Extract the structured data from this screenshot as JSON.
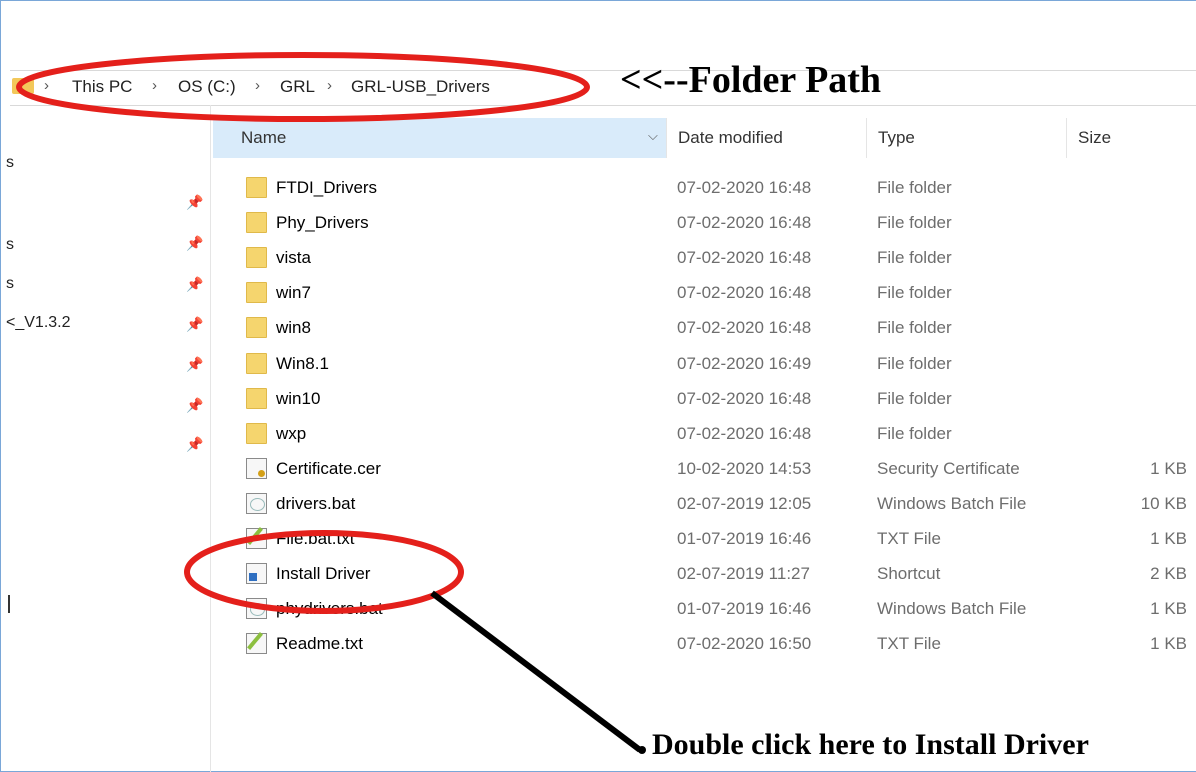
{
  "breadcrumb": [
    "This PC",
    "OS (C:)",
    "GRL",
    "GRL-USB_Drivers"
  ],
  "annotations": {
    "folder_path": "<<--Folder Path",
    "install_hint": "Double click here to Install Driver"
  },
  "nav_pane": {
    "items": [
      "s",
      "s",
      "s",
      "<_V1.3.2"
    ]
  },
  "columns": {
    "name": "Name",
    "date": "Date modified",
    "type": "Type",
    "size": "Size"
  },
  "files": [
    {
      "name": "FTDI_Drivers",
      "date": "07-02-2020 16:48",
      "type": "File folder",
      "size": "",
      "icon": "folder-icon"
    },
    {
      "name": "Phy_Drivers",
      "date": "07-02-2020 16:48",
      "type": "File folder",
      "size": "",
      "icon": "folder-icon"
    },
    {
      "name": "vista",
      "date": "07-02-2020 16:48",
      "type": "File folder",
      "size": "",
      "icon": "folder-icon"
    },
    {
      "name": "win7",
      "date": "07-02-2020 16:48",
      "type": "File folder",
      "size": "",
      "icon": "folder-icon"
    },
    {
      "name": "win8",
      "date": "07-02-2020 16:48",
      "type": "File folder",
      "size": "",
      "icon": "folder-icon"
    },
    {
      "name": "Win8.1",
      "date": "07-02-2020 16:49",
      "type": "File folder",
      "size": "",
      "icon": "folder-icon"
    },
    {
      "name": "win10",
      "date": "07-02-2020 16:48",
      "type": "File folder",
      "size": "",
      "icon": "folder-icon"
    },
    {
      "name": "wxp",
      "date": "07-02-2020 16:48",
      "type": "File folder",
      "size": "",
      "icon": "folder-icon"
    },
    {
      "name": "Certificate.cer",
      "date": "10-02-2020 14:53",
      "type": "Security Certificate",
      "size": "1 KB",
      "icon": "certificate-icon"
    },
    {
      "name": "drivers.bat",
      "date": "02-07-2019 12:05",
      "type": "Windows Batch File",
      "size": "10 KB",
      "icon": "batch-file-icon"
    },
    {
      "name": "File.bat.txt",
      "date": "01-07-2019 16:46",
      "type": "TXT File",
      "size": "1 KB",
      "icon": "text-file-icon"
    },
    {
      "name": "Install Driver",
      "date": "02-07-2019 11:27",
      "type": "Shortcut",
      "size": "2 KB",
      "icon": "shortcut-icon"
    },
    {
      "name": "phydrivers.bat",
      "date": "01-07-2019 16:46",
      "type": "Windows Batch File",
      "size": "1 KB",
      "icon": "batch-file-icon"
    },
    {
      "name": "Readme.txt",
      "date": "07-02-2020 16:50",
      "type": "TXT File",
      "size": "1 KB",
      "icon": "text-file-icon"
    }
  ],
  "colors": {
    "annotation": "#e4201b",
    "header_highlight": "#d9ebfa",
    "folder": "#f5d56e"
  }
}
